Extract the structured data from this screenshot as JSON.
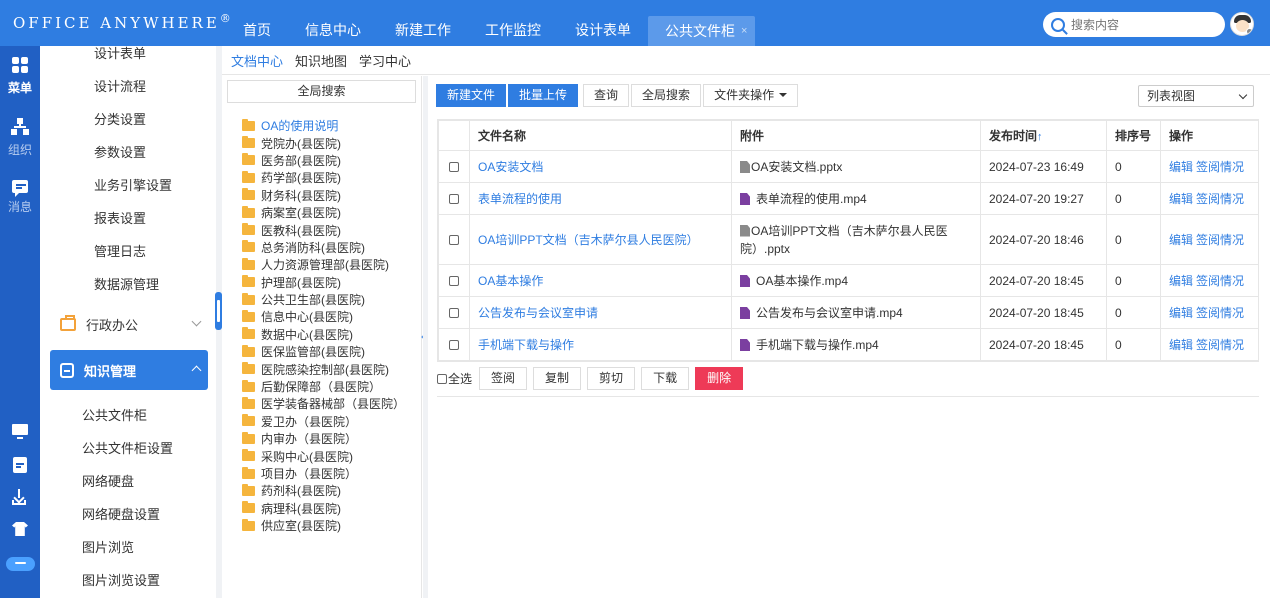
{
  "brand": {
    "name": "OFFICE ANYWHERE",
    "reg": "®"
  },
  "nav": {
    "tabs": [
      "首页",
      "信息中心",
      "新建工作",
      "工作监控",
      "设计表单"
    ],
    "active_tab": "公共文件柜",
    "close_glyph": "×"
  },
  "search": {
    "placeholder": "搜索内容"
  },
  "rail": {
    "menu": "菜单",
    "org": "组织",
    "msg": "消息"
  },
  "sidebar": {
    "items_top": [
      "设计表单",
      "设计流程",
      "分类设置",
      "参数设置",
      "业务引擎设置",
      "报表设置",
      "管理日志",
      "数据源管理"
    ],
    "group_admin": "行政办公",
    "group_knowledge": "知识管理",
    "items_knowledge": [
      "公共文件柜",
      "公共文件柜设置",
      "网络硬盘",
      "网络硬盘设置",
      "图片浏览",
      "图片浏览设置"
    ]
  },
  "subtabs": [
    "文档中心",
    "知识地图",
    "学习中心"
  ],
  "tree": {
    "global_search": "全局搜索",
    "nodes": [
      "OA的使用说明",
      "党院办(县医院)",
      "医务部(县医院)",
      "药学部(县医院)",
      "财务科(县医院)",
      "病案室(县医院)",
      "医教科(县医院)",
      "总务消防科(县医院)",
      "人力资源管理部(县医院)",
      "护理部(县医院)",
      "公共卫生部(县医院)",
      "信息中心(县医院)",
      "数据中心(县医院)",
      "医保监管部(县医院)",
      "医院感染控制部(县医院)",
      "后勤保障部（县医院）",
      "医学装备器械部（县医院）",
      "爱卫办（县医院）",
      "内审办（县医院）",
      "采购中心(县医院)",
      "项目办（县医院）",
      "药剂科(县医院)",
      "病理科(县医院)",
      "供应室(县医院)"
    ]
  },
  "toolbar": {
    "new_file": "新建文件",
    "batch_upload": "批量上传",
    "query": "查询",
    "global_search": "全局搜索",
    "folder_ops": "文件夹操作",
    "view": "列表视图"
  },
  "table": {
    "headers": {
      "name": "文件名称",
      "attachment": "附件",
      "time": "发布时间",
      "sort_arrow": "↑",
      "order": "排序号",
      "ops": "操作"
    },
    "rows": [
      {
        "name": "OA安装文档",
        "attachment": "OA安装文档.pptx",
        "type": "ppt",
        "time": "2024-07-23 16:49",
        "order": "0"
      },
      {
        "name": "表单流程的使用",
        "attachment": "表单流程的使用.mp4",
        "type": "mp4",
        "time": "2024-07-20 19:27",
        "order": "0"
      },
      {
        "name": "OA培训PPT文档（吉木萨尔县人民医院）",
        "attachment": "OA培训PPT文档（吉木萨尔县人民医院）.pptx",
        "type": "ppt",
        "time": "2024-07-20 18:46",
        "order": "0"
      },
      {
        "name": "OA基本操作",
        "attachment": "OA基本操作.mp4",
        "type": "mp4",
        "time": "2024-07-20 18:45",
        "order": "0"
      },
      {
        "name": "公告发布与会议室申请",
        "attachment": "公告发布与会议室申请.mp4",
        "type": "mp4",
        "time": "2024-07-20 18:45",
        "order": "0"
      },
      {
        "name": "手机端下载与操作",
        "attachment": "手机端下载与操作.mp4",
        "type": "mp4",
        "time": "2024-07-20 18:45",
        "order": "0"
      }
    ],
    "op_edit": "编辑",
    "op_status": "签阅情况"
  },
  "footer": {
    "select_all": "全选",
    "sign": "签阅",
    "copy": "复制",
    "cut": "剪切",
    "download": "下载",
    "delete": "删除"
  },
  "colors": {
    "primary": "#2f7de1",
    "rail": "#2160c4",
    "danger": "#ee3a57",
    "folder": "#f5b53d"
  }
}
